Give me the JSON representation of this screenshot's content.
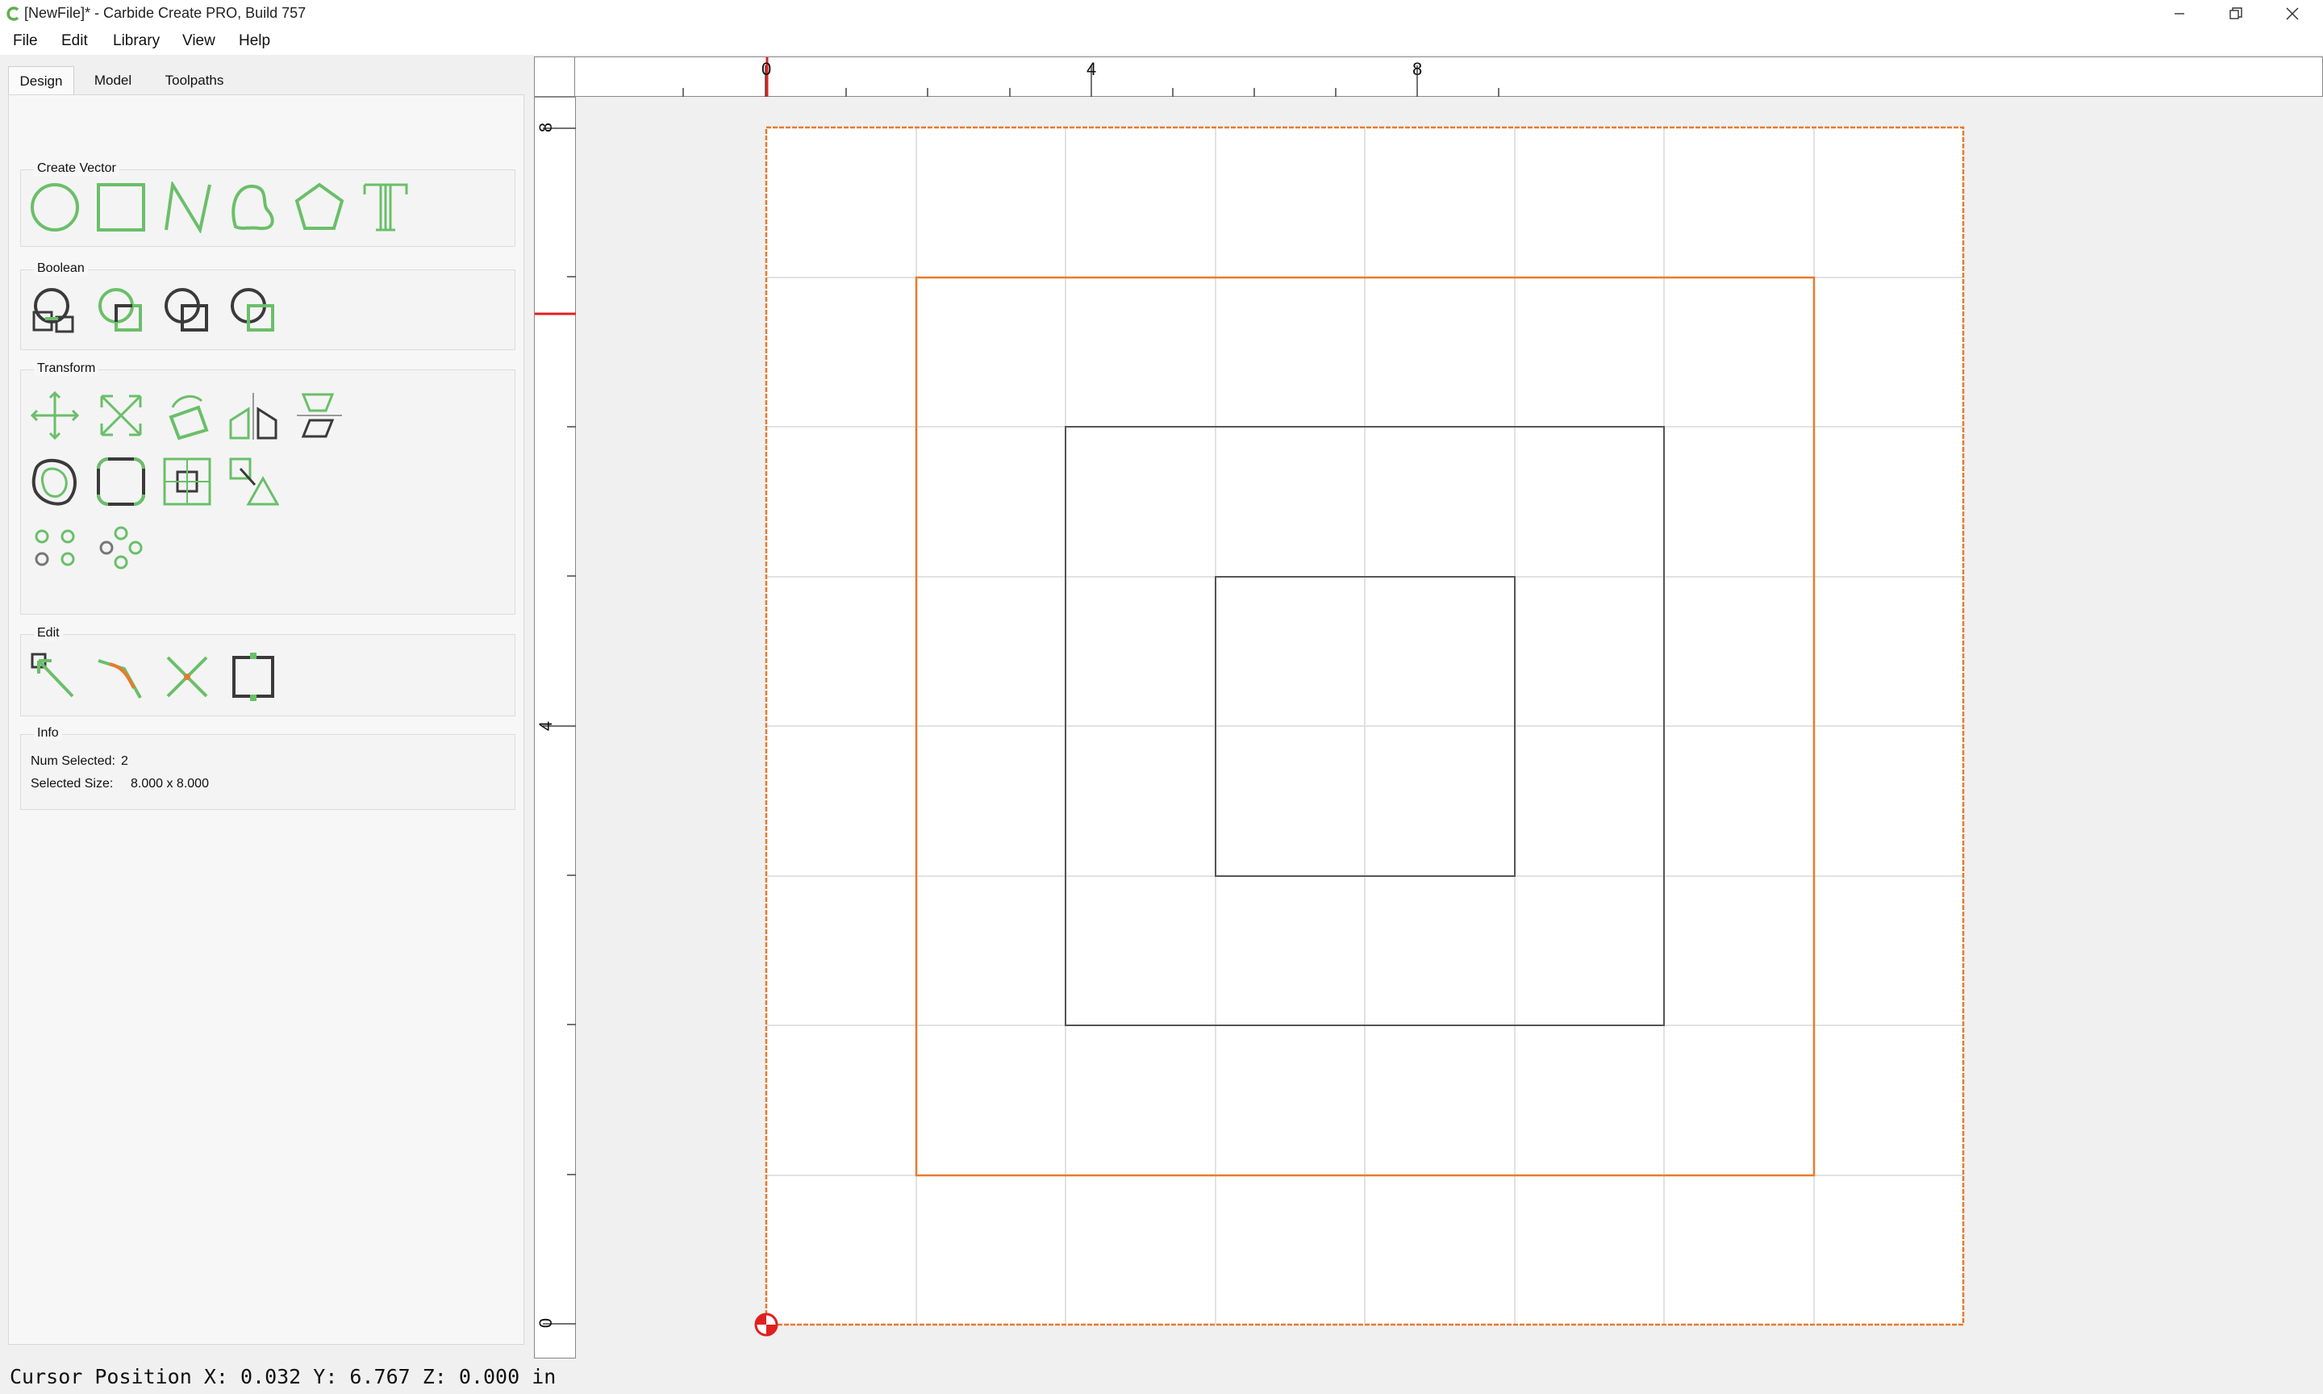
{
  "window": {
    "title": "[NewFile]* - Carbide Create PRO, Build 757"
  },
  "menu": {
    "items": [
      "File",
      "Edit",
      "Library",
      "View",
      "Help"
    ]
  },
  "tabs": [
    "Design",
    "Model",
    "Toolpaths"
  ],
  "groups": {
    "create_vector": "Create Vector",
    "boolean": "Boolean",
    "transform": "Transform",
    "edit": "Edit",
    "info": "Info"
  },
  "info": {
    "num_selected_label": "Num Selected:",
    "num_selected_value": "2",
    "selected_size_label": "Selected Size:",
    "selected_size_value": "8.000 x 8.000"
  },
  "rulers": {
    "top_labels": [
      "0",
      "4",
      "8"
    ],
    "left_labels": [
      "8",
      "4",
      "0"
    ]
  },
  "status": {
    "cursor_position": "Cursor Position X: 0.032 Y: 6.767 Z: 0.000 in"
  },
  "colors": {
    "icon_green": "#6abf69",
    "icon_dark": "#3a3a3a",
    "selection_orange": "#e87a2e",
    "origin_red": "#e02020",
    "grid": "#d9d9d9"
  }
}
